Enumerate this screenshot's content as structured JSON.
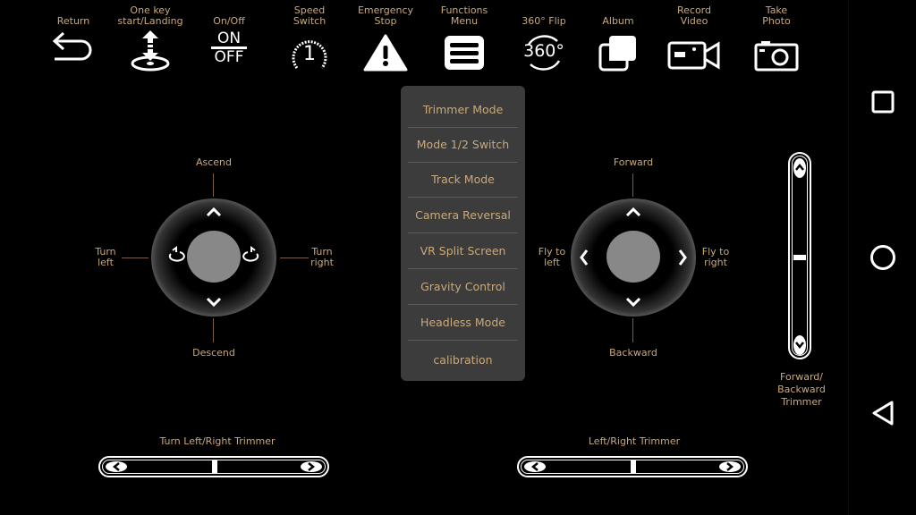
{
  "toolbar": [
    {
      "label": "Return",
      "icon": "return-arrow-icon"
    },
    {
      "label": "One key\nstart/Landing",
      "icon": "takeoff-landing-icon"
    },
    {
      "label": "On/Off",
      "icon": "on-off-icon",
      "icon_top": "ON",
      "icon_bottom": "OFF"
    },
    {
      "label": "Speed\nSwitch",
      "icon": "speed-gauge-icon",
      "value": "1"
    },
    {
      "label": "Emergency\nStop",
      "icon": "warning-icon"
    },
    {
      "label": "Functions\nMenu",
      "icon": "menu-icon"
    },
    {
      "label": "360° Flip",
      "icon": "flip-360-icon",
      "icon_text": "360°"
    },
    {
      "label": "Album",
      "icon": "album-icon"
    },
    {
      "label": "Record\nVideo",
      "icon": "video-camera-icon"
    },
    {
      "label": "Take\nPhoto",
      "icon": "photo-camera-icon"
    }
  ],
  "functions_menu": [
    "Trimmer Mode",
    "Mode 1/2 Switch",
    "Track Mode",
    "Camera Reversal",
    "VR Split Screen",
    "Gravity Control",
    "Headless Mode",
    "calibration"
  ],
  "left_stick": {
    "up": "Ascend",
    "down": "Descend",
    "left": "Turn\nleft",
    "right": "Turn\nright"
  },
  "right_stick": {
    "up": "Forward",
    "down": "Backward",
    "left": "Fly to\nleft",
    "right": "Fly to\nright"
  },
  "trimmers": {
    "left": {
      "label": "Turn Left/Right Trimmer",
      "value": 0
    },
    "right": {
      "label": "Left/Right Trimmer",
      "value": 0
    },
    "vertical": {
      "label": "Forward/\nBackward\nTrimmer",
      "value": 0
    }
  },
  "colors": {
    "label": "#c9a97a",
    "menu_bg": "#3c3c3c",
    "knob": "#888888"
  }
}
